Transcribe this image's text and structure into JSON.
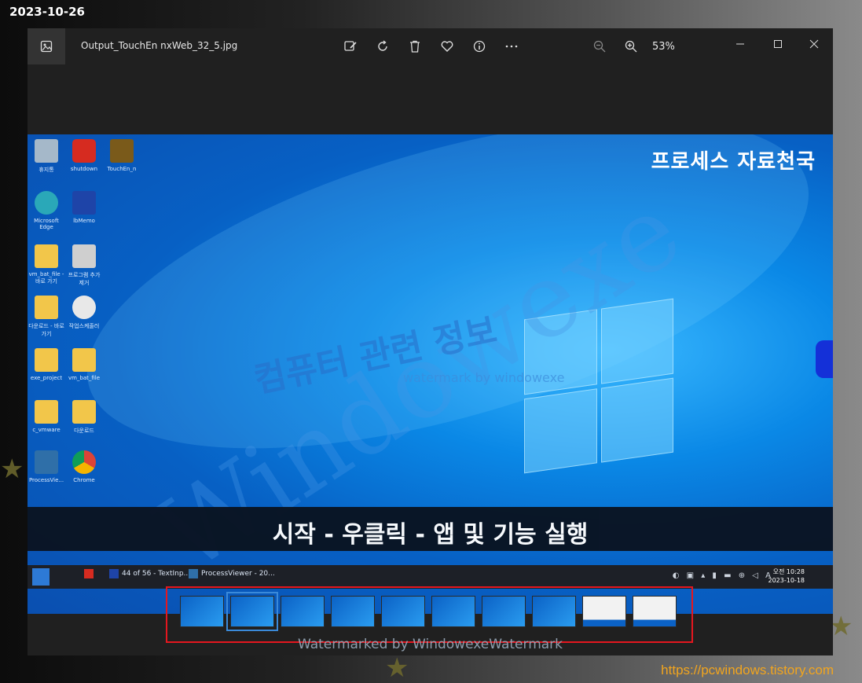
{
  "overlay": {
    "date_stamp": "2023-10-26",
    "site_url": "https://pcwindows.tistory.com",
    "bottom_watermark": "Watermarked by WindowexeWatermark"
  },
  "titlebar": {
    "file_name": "Output_TouchEn nxWeb_32_5.jpg",
    "zoom_level": "53%"
  },
  "photo": {
    "brand_text": "프로세스 자료천국",
    "subtitle": "시작 - 우클릭 - 앱 및 기능 실행",
    "watermark_korean": "컴퓨터 관련 정보",
    "watermark_small": "watermark by windowexe",
    "watermark_big": "Windowexe",
    "desktop_icons": [
      {
        "label": "휴지통",
        "icon": "recycle-bin"
      },
      {
        "label": "shutdown",
        "icon": "power"
      },
      {
        "label": "TouchEn_n",
        "icon": "nx"
      },
      {
        "label": "Microsoft Edge",
        "icon": "edge"
      },
      {
        "label": "lbMemo",
        "icon": "m"
      },
      {
        "label": "vm_bat_file - 바로 가기",
        "icon": "folder"
      },
      {
        "label": "프로그램 추가 제거",
        "icon": "app"
      },
      {
        "label": "다운로드 - 바로 가기",
        "icon": "folder"
      },
      {
        "label": "작업스케줄러",
        "icon": "clock"
      },
      {
        "label": "exe_project",
        "icon": "folder"
      },
      {
        "label": "vm_bat_file",
        "icon": "folder"
      },
      {
        "label": "c_vmware",
        "icon": "folder"
      },
      {
        "label": "다운로드",
        "icon": "folder"
      },
      {
        "label": "ProcessVie...",
        "icon": "processviewer"
      },
      {
        "label": "Chrome",
        "icon": "chrome"
      }
    ],
    "taskbar": {
      "items": [
        "44 of 56 - TextInp...",
        "ProcessViewer - 20..."
      ],
      "clock_time": "오전 10:28",
      "clock_date": "2023-10-18",
      "ime": "A"
    }
  },
  "filmstrip": {
    "count": 11,
    "selected_index": 1
  }
}
